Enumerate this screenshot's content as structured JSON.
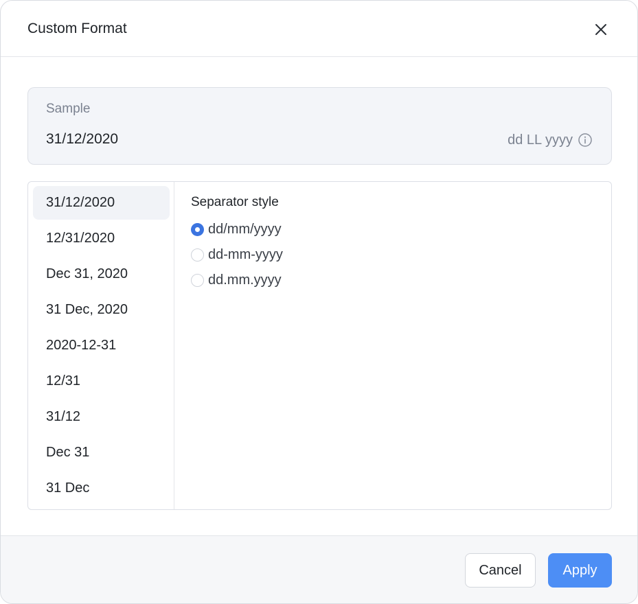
{
  "dialog": {
    "title": "Custom Format"
  },
  "sample": {
    "label": "Sample",
    "value": "31/12/2020",
    "pattern": "dd LL yyyy"
  },
  "formats": [
    "31/12/2020",
    "12/31/2020",
    "Dec 31, 2020",
    "31 Dec, 2020",
    "2020-12-31",
    "12/31",
    "31/12",
    "Dec 31",
    "31 Dec"
  ],
  "selected_format": "31/12/2020",
  "separator": {
    "title": "Separator style",
    "options": [
      "dd/mm/yyyy",
      "dd-mm-yyyy",
      "dd.mm.yyyy"
    ],
    "selected": "dd/mm/yyyy"
  },
  "footer": {
    "cancel_label": "Cancel",
    "apply_label": "Apply"
  },
  "colors": {
    "accent": "#4d8ef5",
    "radio_checked": "#3b74e0",
    "sample_bg": "#f3f5f9",
    "selected_item_bg": "#f1f3f7"
  }
}
